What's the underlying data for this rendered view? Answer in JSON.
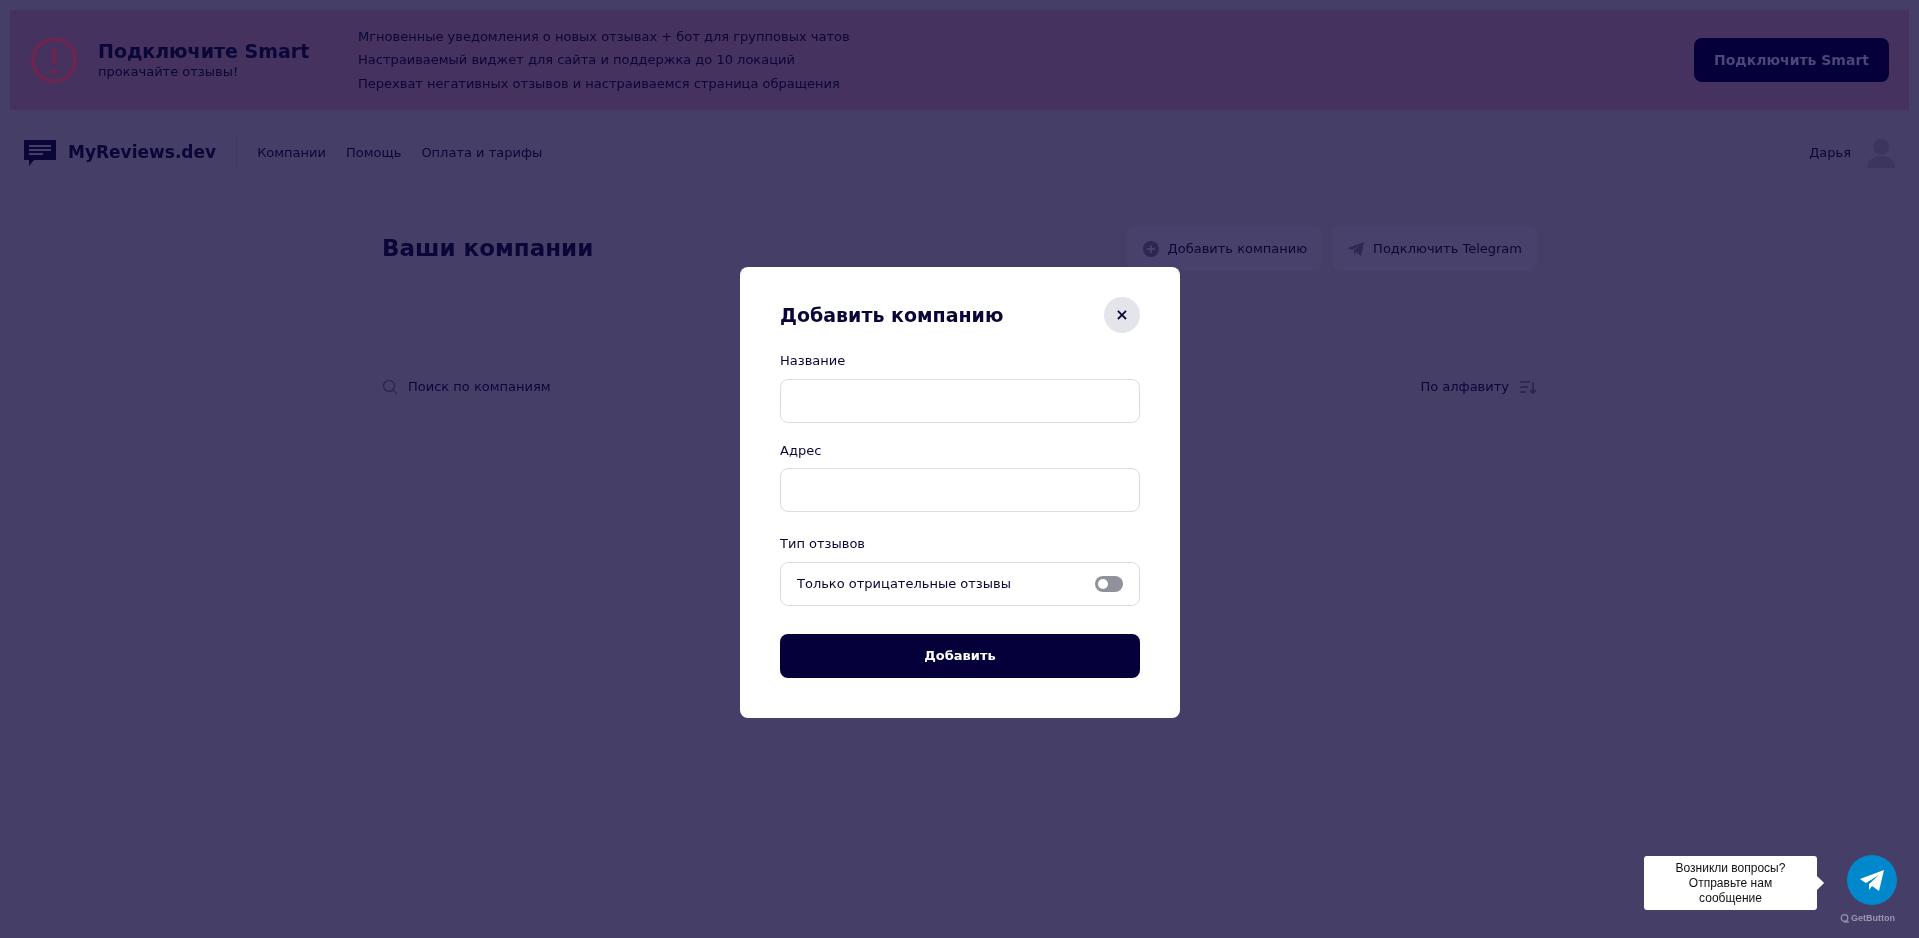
{
  "banner": {
    "title": "Подключите Smart",
    "subtitle": "прокачайте отзывы!",
    "features": [
      "Мгновенные уведомления о новых отзывах + бот для групповых чатов",
      "Настраиваемый виджет для сайта и поддержка до 10 локаций",
      "Перехват негативных отзывов и настраиваемся страница обращения"
    ],
    "button": "Подключить Smart"
  },
  "nav": {
    "logo": "MyReviews.dev",
    "links": [
      "Компании",
      "Помощь",
      "Оплата и тарифы"
    ],
    "user": "Дарья"
  },
  "page": {
    "title": "Ваши компании",
    "actions": [
      {
        "kind": "add",
        "label": "Добавить компанию"
      },
      {
        "kind": "telegram",
        "label": "Подключить Telegram"
      }
    ],
    "search": {
      "placeholder": "Поиск по компаниям"
    },
    "sort": "По алфавиту"
  },
  "modal": {
    "title": "Добавить компанию",
    "close": "×",
    "fields": [
      {
        "label": "Название"
      },
      {
        "label": "Адрес"
      }
    ],
    "review_type": {
      "label": "Тип отзывов",
      "option": "Только отрицательные отзывы",
      "on": false
    },
    "submit": "Добавить"
  },
  "chat_widget": {
    "bubble": "Возникли вопросы? Отправьте нам сообщение",
    "brand": "GetButton"
  }
}
